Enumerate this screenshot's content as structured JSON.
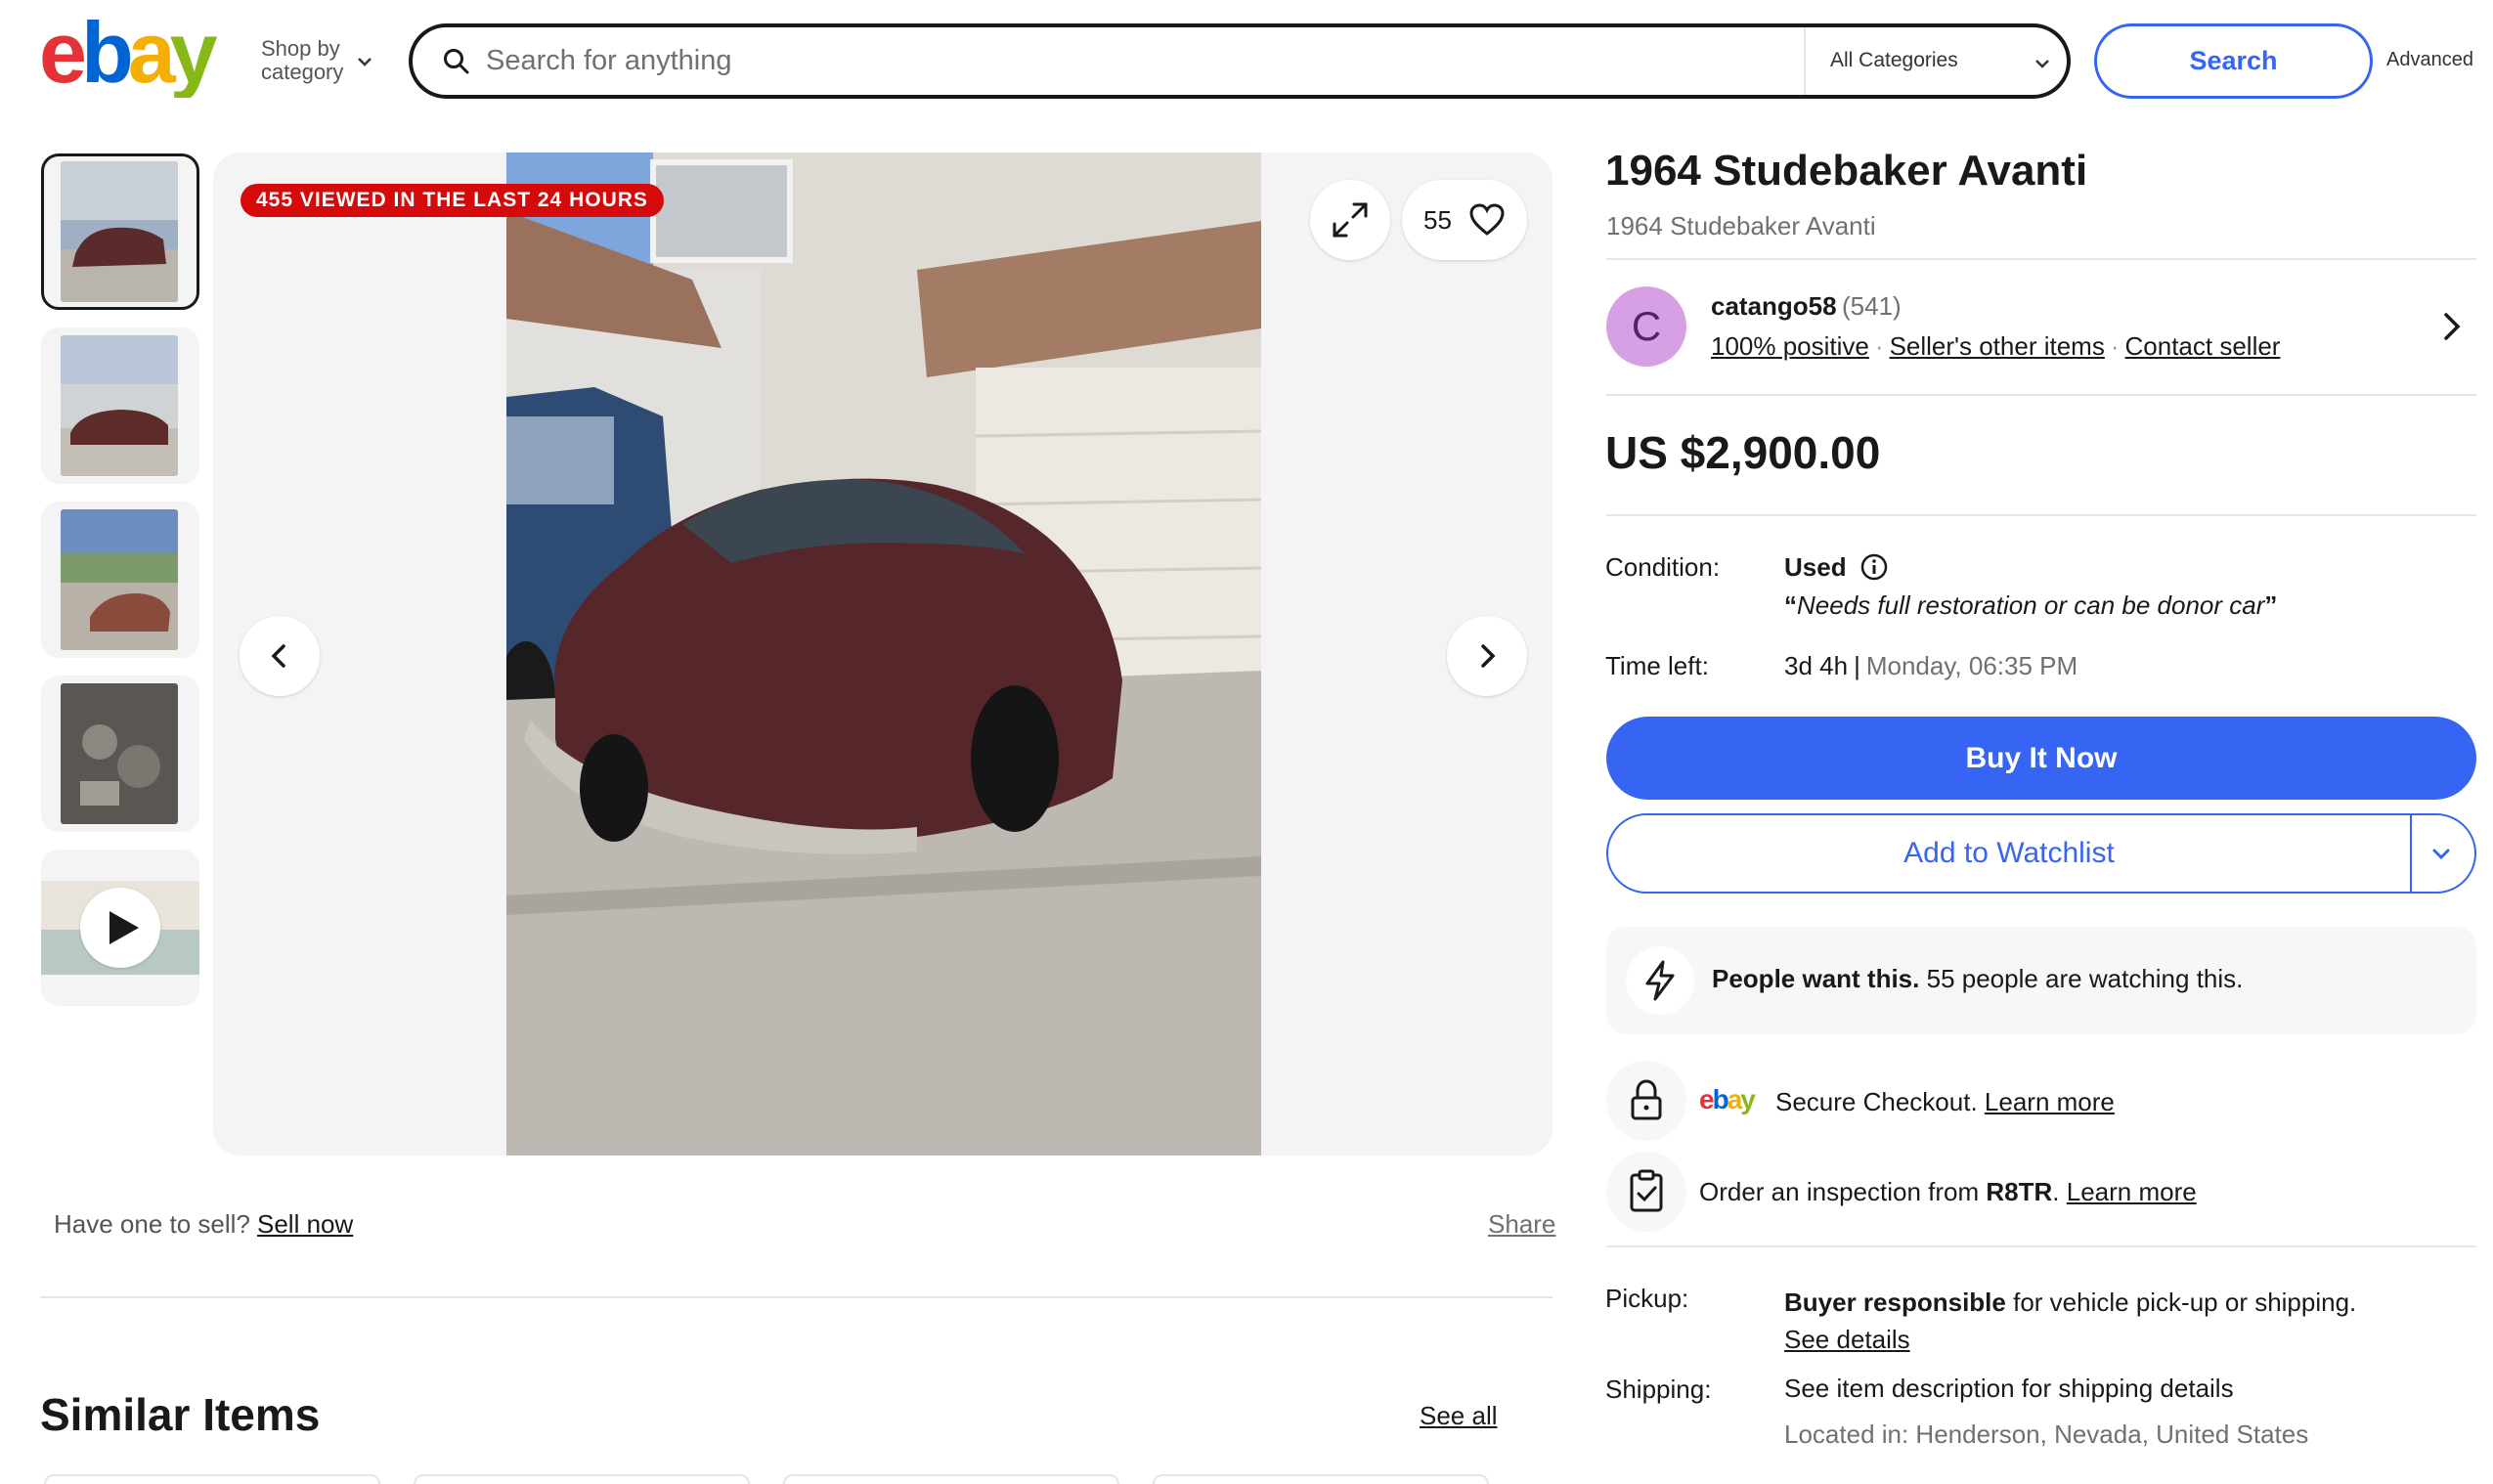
{
  "header": {
    "logo_text": "ebay",
    "shop_by_line1": "Shop by",
    "shop_by_line2": "category",
    "search_placeholder": "Search for anything",
    "category_select": "All Categories",
    "search_button": "Search",
    "advanced_link": "Advanced"
  },
  "gallery": {
    "thumbnails": [
      "photo-1",
      "photo-2",
      "photo-3",
      "photo-4",
      "video"
    ],
    "viewed_badge": "455 VIEWED IN THE LAST 24 HOURS",
    "watch_count": "55",
    "sell_prompt": "Have one to sell?",
    "sell_link": "Sell now",
    "share_link": "Share"
  },
  "similar": {
    "title": "Similar Items",
    "see_all": "See all"
  },
  "listing": {
    "title": "1964 Studebaker Avanti",
    "subtitle": "1964 Studebaker Avanti",
    "seller": {
      "avatar_letter": "C",
      "name": "catango58",
      "feedback_count": "(541)",
      "positive": "100% positive",
      "other_items": "Seller's other items",
      "contact": "Contact seller"
    },
    "price": "US $2,900.00",
    "condition_label": "Condition:",
    "condition_value": "Used",
    "condition_note": "Needs full restoration or can be donor car",
    "time_left_label": "Time left:",
    "time_left_value": "3d 4h",
    "time_left_end": "Monday, 06:35 PM",
    "buy_button": "Buy It Now",
    "watchlist_button": "Add to Watchlist",
    "people_want_bold": "People want this.",
    "people_want_rest": "55 people are watching this.",
    "secure_text": "Secure Checkout.",
    "secure_link": "Learn more",
    "inspection_prefix": "Order an inspection from",
    "inspection_vendor": "R8TR",
    "inspection_link": "Learn more",
    "pickup_label": "Pickup:",
    "pickup_bold": "Buyer responsible",
    "pickup_rest": "for vehicle pick-up or shipping.",
    "pickup_link": "See details",
    "shipping_label": "Shipping:",
    "shipping_value": "See item description for shipping details",
    "location": "Located in: Henderson, Nevada, United States"
  },
  "colors": {
    "ebay_red": "#e53238",
    "ebay_blue": "#0064d2",
    "ebay_yellow": "#f5af02",
    "ebay_green": "#86b817",
    "primary_blue": "#3665f3",
    "badge_red": "#d50b0b"
  }
}
